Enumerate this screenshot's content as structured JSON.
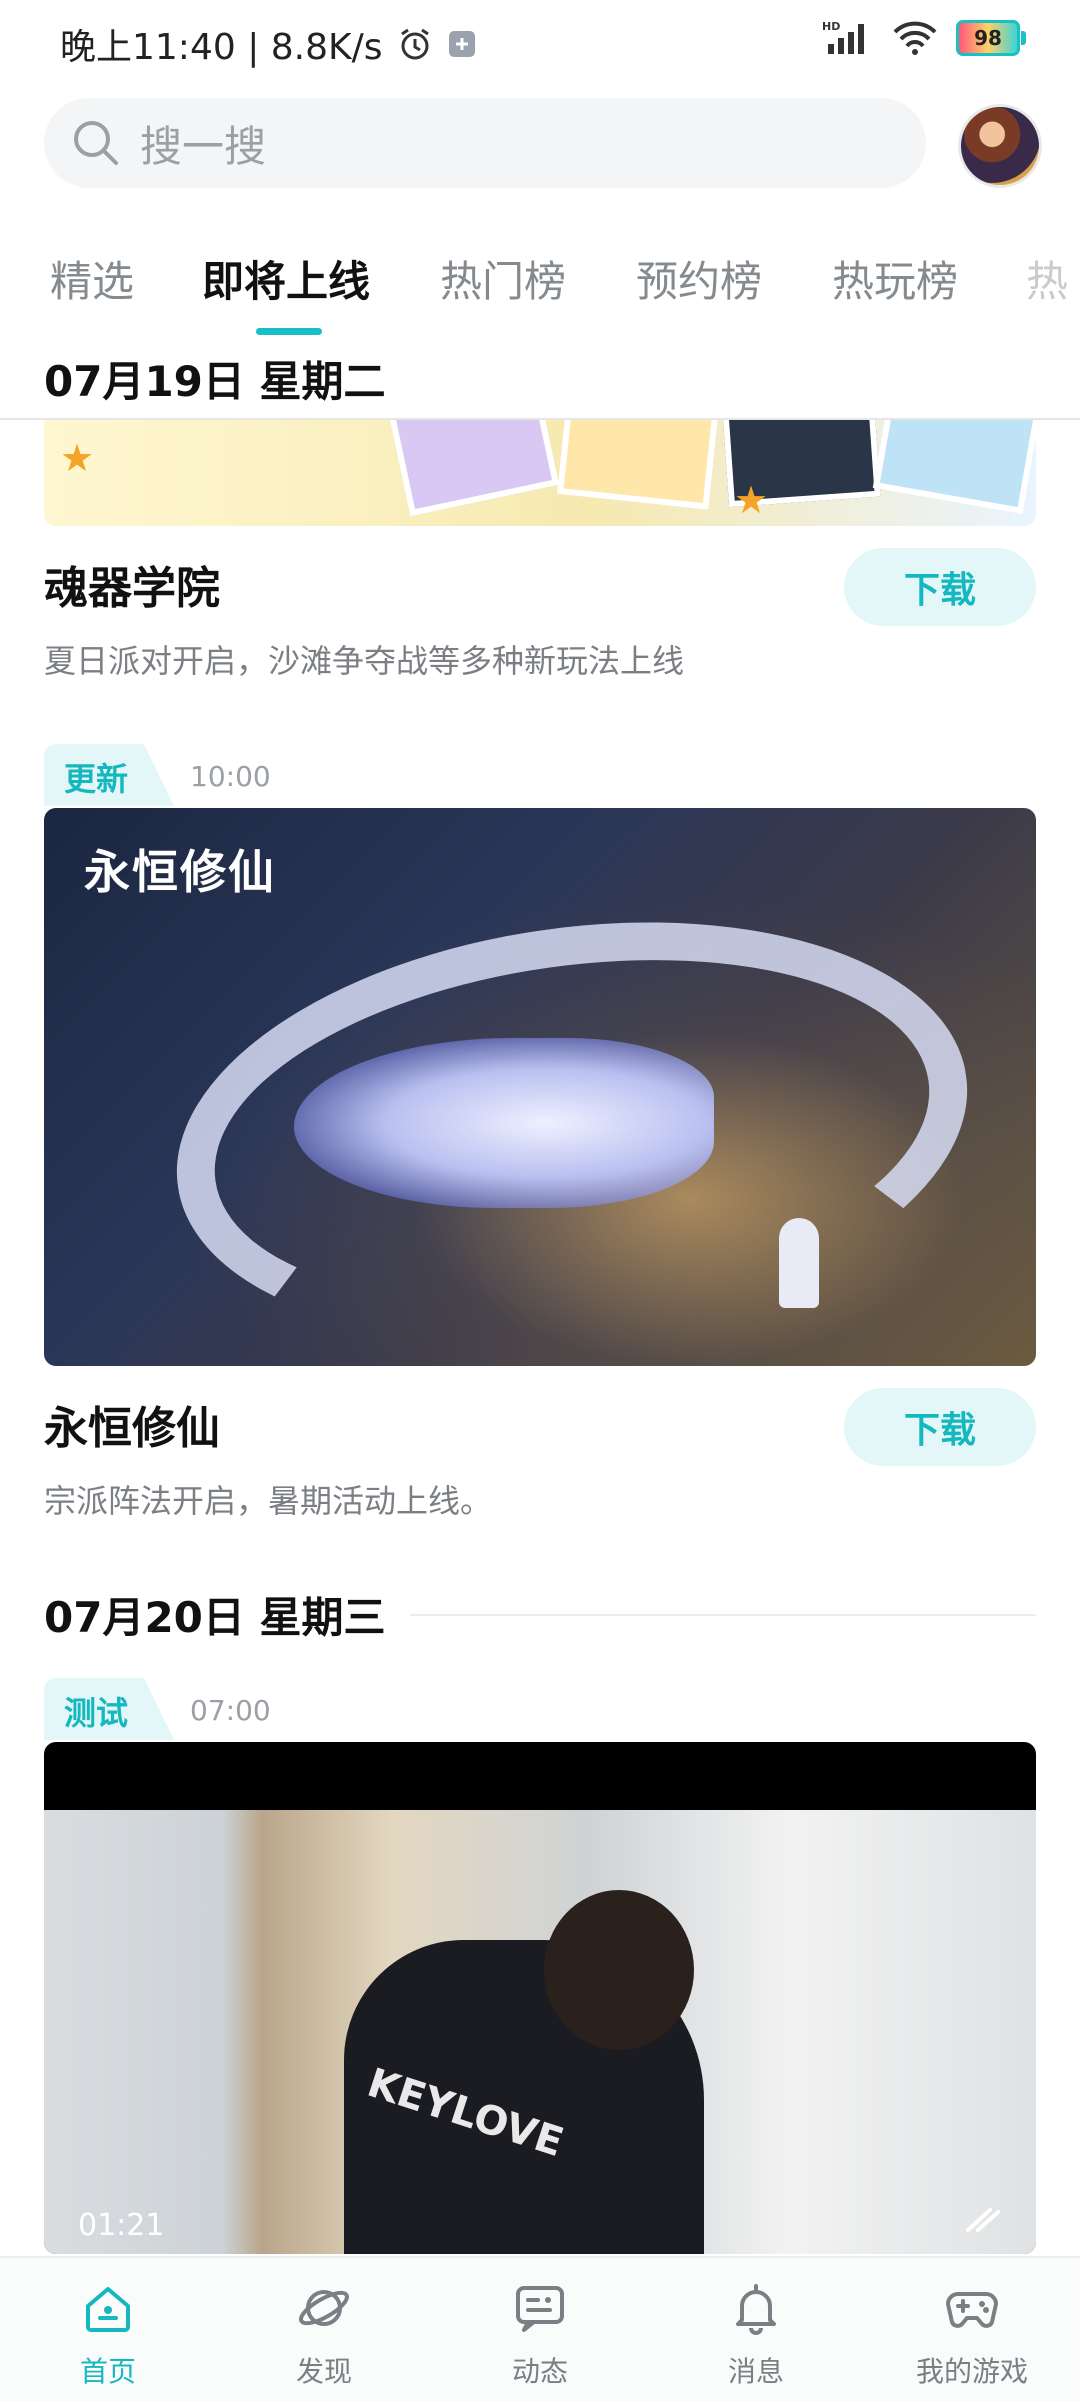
{
  "status_bar": {
    "time_speed": "晚上11:40 | 8.8K/s",
    "network": "HD",
    "battery": "98"
  },
  "search": {
    "placeholder": "搜一搜"
  },
  "tabs": [
    {
      "label": "精选"
    },
    {
      "label": "即将上线"
    },
    {
      "label": "热门榜"
    },
    {
      "label": "预约榜"
    },
    {
      "label": "热玩榜"
    },
    {
      "label": "热"
    }
  ],
  "active_tab": "即将上线",
  "sticky_date": "07月19日 星期二",
  "games": [
    {
      "title": "魂器学院",
      "desc": "夏日派对开启，沙滩争夺战等多种新玩法上线",
      "button": "下载"
    },
    {
      "tag": "更新",
      "time": "10:00",
      "art_text": "永恒修仙",
      "title": "永恒修仙",
      "desc": "宗派阵法开启，暑期活动上线。",
      "button": "下载"
    },
    {
      "tag": "测试",
      "time": "07:00",
      "video_duration": "01:21",
      "shirt_text": "KEYLOVE"
    }
  ],
  "date_2": "07月20日 星期三",
  "nav": [
    {
      "label": "首页",
      "icon": "home-icon"
    },
    {
      "label": "发现",
      "icon": "planet-icon"
    },
    {
      "label": "动态",
      "icon": "feed-icon"
    },
    {
      "label": "消息",
      "icon": "bell-icon"
    },
    {
      "label": "我的游戏",
      "icon": "gamepad-icon"
    }
  ],
  "colors": {
    "accent": "#16b8bf",
    "accent_bg": "#e4f7f8",
    "muted": "#7b7f84"
  }
}
